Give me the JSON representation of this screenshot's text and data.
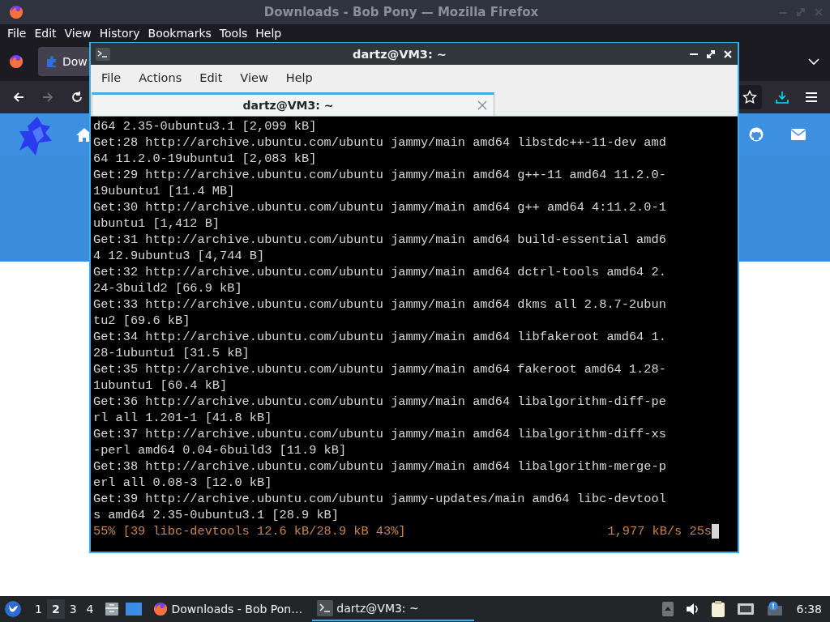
{
  "browser": {
    "title": "Downloads - Bob Pony — Mozilla Firefox",
    "menu": [
      "File",
      "Edit",
      "View",
      "History",
      "Bookmarks",
      "Tools",
      "Help"
    ],
    "tab": {
      "label": "Dow",
      "selected": true
    },
    "nav_buttons": [
      {
        "kind": "back",
        "disabled": false
      },
      {
        "kind": "forward",
        "disabled": true
      },
      {
        "kind": "reload",
        "disabled": false
      }
    ]
  },
  "terminal": {
    "title": "dartz@VM3: ~",
    "menu": [
      "File",
      "Actions",
      "Edit",
      "View",
      "Help"
    ],
    "tabs": [
      {
        "label": "dartz@VM3: ~",
        "selected": true
      }
    ],
    "lines": [
      "d64 2.35-0ubuntu3.1 [2,099 kB]",
      "Get:28 http://archive.ubuntu.com/ubuntu jammy/main amd64 libstdc++-11-dev amd",
      "64 11.2.0-19ubuntu1 [2,083 kB]",
      "Get:29 http://archive.ubuntu.com/ubuntu jammy/main amd64 g++-11 amd64 11.2.0-",
      "19ubuntu1 [11.4 MB]",
      "Get:30 http://archive.ubuntu.com/ubuntu jammy/main amd64 g++ amd64 4:11.2.0-1",
      "ubuntu1 [1,412 B]",
      "Get:31 http://archive.ubuntu.com/ubuntu jammy/main amd64 build-essential amd6",
      "4 12.9ubuntu3 [4,744 B]",
      "Get:32 http://archive.ubuntu.com/ubuntu jammy/main amd64 dctrl-tools amd64 2.",
      "24-3build2 [66.9 kB]",
      "Get:33 http://archive.ubuntu.com/ubuntu jammy/main amd64 dkms all 2.8.7-2ubun",
      "tu2 [69.6 kB]",
      "Get:34 http://archive.ubuntu.com/ubuntu jammy/main amd64 libfakeroot amd64 1.",
      "28-1ubuntu1 [31.5 kB]",
      "Get:35 http://archive.ubuntu.com/ubuntu jammy/main amd64 fakeroot amd64 1.28-",
      "1ubuntu1 [60.4 kB]",
      "Get:36 http://archive.ubuntu.com/ubuntu jammy/main amd64 libalgorithm-diff-pe",
      "rl all 1.201-1 [41.8 kB]",
      "Get:37 http://archive.ubuntu.com/ubuntu jammy/main amd64 libalgorithm-diff-xs",
      "-perl amd64 0.04-6build3 [11.9 kB]",
      "Get:38 http://archive.ubuntu.com/ubuntu jammy/main amd64 libalgorithm-merge-p",
      "erl all 0.08-3 [12.0 kB]",
      "Get:39 http://archive.ubuntu.com/ubuntu jammy-updates/main amd64 libc-devtool",
      "s amd64 2.35-0ubuntu3.1 [28.9 kB]"
    ],
    "status": {
      "progress": "55% [39 libc-devtools 12.6 kB/28.9 kB 43%]",
      "rate": "1,977 kB/s 25s"
    }
  },
  "taskbar": {
    "workspaces": [
      {
        "label": "1",
        "selected": false
      },
      {
        "label": "2",
        "selected": true
      },
      {
        "label": "3",
        "selected": false
      },
      {
        "label": "4",
        "selected": false
      }
    ],
    "tasks": [
      {
        "kind": "browser",
        "label": "Downloads - Bob Pon…",
        "selected": false
      },
      {
        "kind": "terminal",
        "label": "dartz@VM3: ~",
        "selected": true
      }
    ],
    "clock": "6:38"
  }
}
